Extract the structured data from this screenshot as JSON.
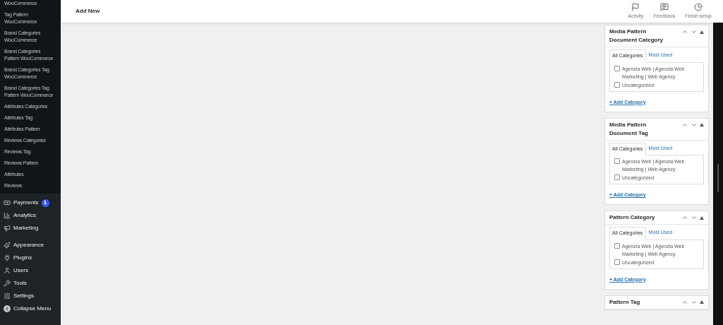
{
  "sidebar": {
    "submenu": [
      "WooCommerce",
      "Tag Pattern WooCommerce",
      "Brand Categories WooCommerce",
      "Brand Categories Pattern WooCommerce",
      "Brand Categories Tag WooCommerce",
      "Brand Categories Tag Pattern WooCommerce",
      "Attributes Categories",
      "Attributes Tag",
      "Attributes Pattern",
      "Reviews Categories",
      "Reviews Tag",
      "Reviews Pattern",
      "Attributes",
      "Reviews"
    ],
    "menu": [
      {
        "label": "Payments",
        "kind": "payments",
        "badge": "1"
      },
      {
        "label": "Analytics",
        "kind": "analytics"
      },
      {
        "label": "Marketing",
        "kind": "marketing"
      },
      {
        "label": "Appearance",
        "kind": "appearance"
      },
      {
        "label": "Plugins",
        "kind": "plugins"
      },
      {
        "label": "Users",
        "kind": "users"
      },
      {
        "label": "Tools",
        "kind": "tools"
      },
      {
        "label": "Settings",
        "kind": "settings"
      },
      {
        "label": "Collapse Menu",
        "kind": "collapse"
      }
    ]
  },
  "header": {
    "title": "Add New",
    "actions": [
      {
        "label": "Activity",
        "kind": "activity"
      },
      {
        "label": "Feedback",
        "kind": "feedback"
      },
      {
        "label": "Finish setup",
        "kind": "setup"
      }
    ]
  },
  "panels": [
    {
      "title": "Media Pattern Document Category",
      "tabs": [
        {
          "label": "All Categories",
          "selected": true
        },
        {
          "label": "Most Used",
          "selected": false
        }
      ],
      "items": [
        {
          "label": "Agenzia Web | Agenzia Web Marketing | Web Agency",
          "checked": false
        },
        {
          "label": "Uncategorized",
          "checked": false
        }
      ],
      "add": "+ Add Category"
    },
    {
      "title": "Media Pattern Document Tag",
      "tabs": [
        {
          "label": "All Categories",
          "selected": true
        },
        {
          "label": "Most Used",
          "selected": false
        }
      ],
      "items": [
        {
          "label": "Agenzia Web | Agenzia Web Marketing | Web Agency",
          "checked": false
        },
        {
          "label": "Uncategorized",
          "checked": false
        }
      ],
      "add": "+ Add Category"
    },
    {
      "title": "Pattern Category",
      "tabs": [
        {
          "label": "All Categories",
          "selected": true
        },
        {
          "label": "Most Used",
          "selected": false
        }
      ],
      "items": [
        {
          "label": "Agenzia Web | Agenzia Web Marketing | Web Agency",
          "checked": false
        },
        {
          "label": "Uncategorized",
          "checked": false
        }
      ],
      "add": "+ Add Category"
    },
    {
      "title": "Pattern Tag"
    }
  ]
}
